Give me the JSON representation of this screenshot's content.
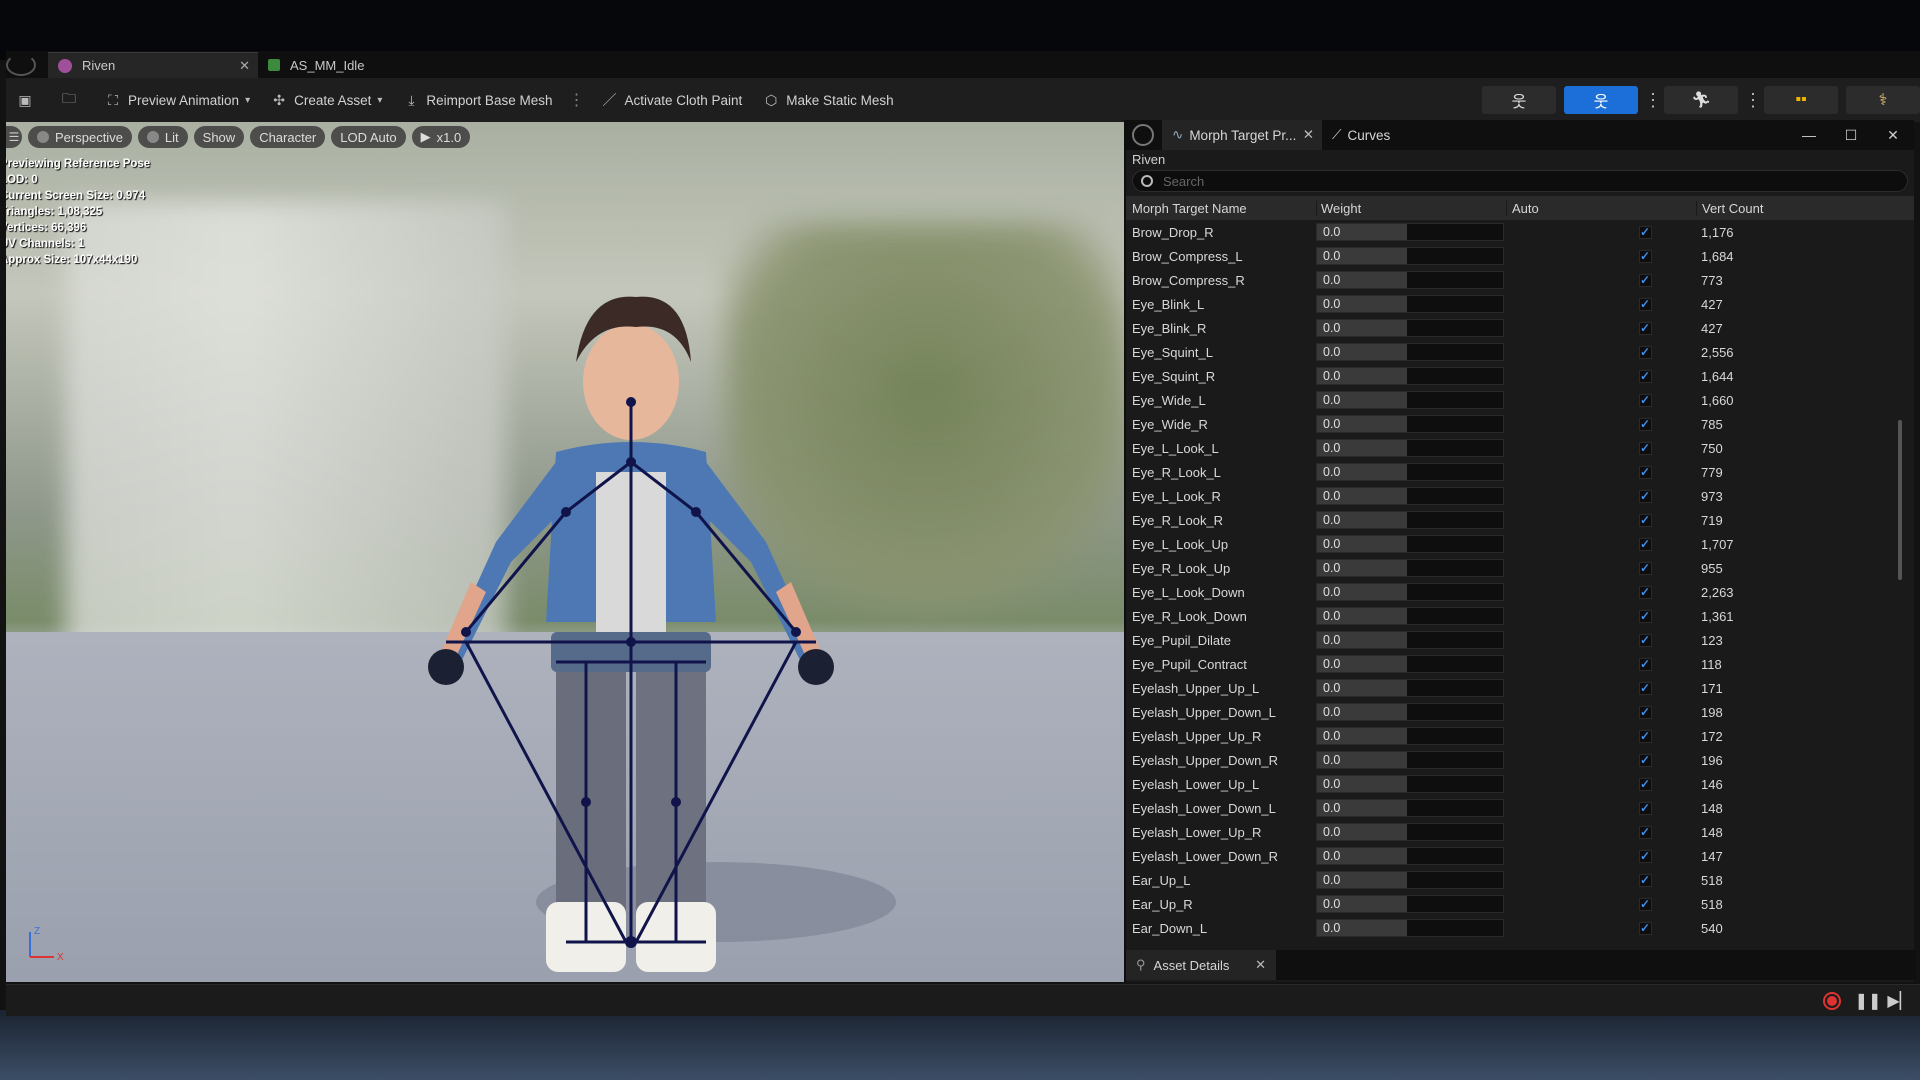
{
  "tabs": [
    {
      "label": "Riven",
      "active": true
    },
    {
      "label": "AS_MM_Idle",
      "active": false
    }
  ],
  "toolbar": {
    "preview_animation": "Preview Animation",
    "create_asset": "Create Asset",
    "reimport_base_mesh": "Reimport Base Mesh",
    "activate_cloth_paint": "Activate Cloth Paint",
    "make_static_mesh": "Make Static Mesh"
  },
  "viewport": {
    "pills": {
      "perspective": "Perspective",
      "lit": "Lit",
      "show": "Show",
      "character": "Character",
      "lod": "LOD Auto",
      "speed": "x1.0"
    },
    "stats": [
      "Previewing Reference Pose",
      "LOD: 0",
      "Current Screen Size: 0.974",
      "Triangles: 1,08,325",
      "Vertices: 66,396",
      "UV Channels: 1",
      "Approx Size: 107x44x190"
    ],
    "axis_z": "Z",
    "axis_x": "X"
  },
  "panel": {
    "tabs": [
      "Morph Target Pr...",
      "Curves"
    ],
    "asset_name": "Riven",
    "search_placeholder": "Search",
    "columns": [
      "Morph Target Name",
      "Weight",
      "Auto",
      "Vert Count"
    ],
    "rows": [
      {
        "name": "Brow_Drop_R",
        "weight": "0.0",
        "auto": true,
        "vert_count": "1,176"
      },
      {
        "name": "Brow_Compress_L",
        "weight": "0.0",
        "auto": true,
        "vert_count": "1,684"
      },
      {
        "name": "Brow_Compress_R",
        "weight": "0.0",
        "auto": true,
        "vert_count": "773"
      },
      {
        "name": "Eye_Blink_L",
        "weight": "0.0",
        "auto": true,
        "vert_count": "427"
      },
      {
        "name": "Eye_Blink_R",
        "weight": "0.0",
        "auto": true,
        "vert_count": "427"
      },
      {
        "name": "Eye_Squint_L",
        "weight": "0.0",
        "auto": true,
        "vert_count": "2,556"
      },
      {
        "name": "Eye_Squint_R",
        "weight": "0.0",
        "auto": true,
        "vert_count": "1,644"
      },
      {
        "name": "Eye_Wide_L",
        "weight": "0.0",
        "auto": true,
        "vert_count": "1,660"
      },
      {
        "name": "Eye_Wide_R",
        "weight": "0.0",
        "auto": true,
        "vert_count": "785"
      },
      {
        "name": "Eye_L_Look_L",
        "weight": "0.0",
        "auto": true,
        "vert_count": "750"
      },
      {
        "name": "Eye_R_Look_L",
        "weight": "0.0",
        "auto": true,
        "vert_count": "779"
      },
      {
        "name": "Eye_L_Look_R",
        "weight": "0.0",
        "auto": true,
        "vert_count": "973"
      },
      {
        "name": "Eye_R_Look_R",
        "weight": "0.0",
        "auto": true,
        "vert_count": "719"
      },
      {
        "name": "Eye_L_Look_Up",
        "weight": "0.0",
        "auto": true,
        "vert_count": "1,707"
      },
      {
        "name": "Eye_R_Look_Up",
        "weight": "0.0",
        "auto": true,
        "vert_count": "955"
      },
      {
        "name": "Eye_L_Look_Down",
        "weight": "0.0",
        "auto": true,
        "vert_count": "2,263"
      },
      {
        "name": "Eye_R_Look_Down",
        "weight": "0.0",
        "auto": true,
        "vert_count": "1,361"
      },
      {
        "name": "Eye_Pupil_Dilate",
        "weight": "0.0",
        "auto": true,
        "vert_count": "123"
      },
      {
        "name": "Eye_Pupil_Contract",
        "weight": "0.0",
        "auto": true,
        "vert_count": "118"
      },
      {
        "name": "Eyelash_Upper_Up_L",
        "weight": "0.0",
        "auto": true,
        "vert_count": "171"
      },
      {
        "name": "Eyelash_Upper_Down_L",
        "weight": "0.0",
        "auto": true,
        "vert_count": "198"
      },
      {
        "name": "Eyelash_Upper_Up_R",
        "weight": "0.0",
        "auto": true,
        "vert_count": "172"
      },
      {
        "name": "Eyelash_Upper_Down_R",
        "weight": "0.0",
        "auto": true,
        "vert_count": "196"
      },
      {
        "name": "Eyelash_Lower_Up_L",
        "weight": "0.0",
        "auto": true,
        "vert_count": "146"
      },
      {
        "name": "Eyelash_Lower_Down_L",
        "weight": "0.0",
        "auto": true,
        "vert_count": "148"
      },
      {
        "name": "Eyelash_Lower_Up_R",
        "weight": "0.0",
        "auto": true,
        "vert_count": "148"
      },
      {
        "name": "Eyelash_Lower_Down_R",
        "weight": "0.0",
        "auto": true,
        "vert_count": "147"
      },
      {
        "name": "Ear_Up_L",
        "weight": "0.0",
        "auto": true,
        "vert_count": "518"
      },
      {
        "name": "Ear_Up_R",
        "weight": "0.0",
        "auto": true,
        "vert_count": "518"
      },
      {
        "name": "Ear_Down_L",
        "weight": "0.0",
        "auto": true,
        "vert_count": "540"
      }
    ],
    "asset_details_tab": "Asset Details"
  },
  "colors": {
    "accent": "#1c6fd8",
    "record": "#dd3333",
    "checkbox": "#3b8be8"
  }
}
